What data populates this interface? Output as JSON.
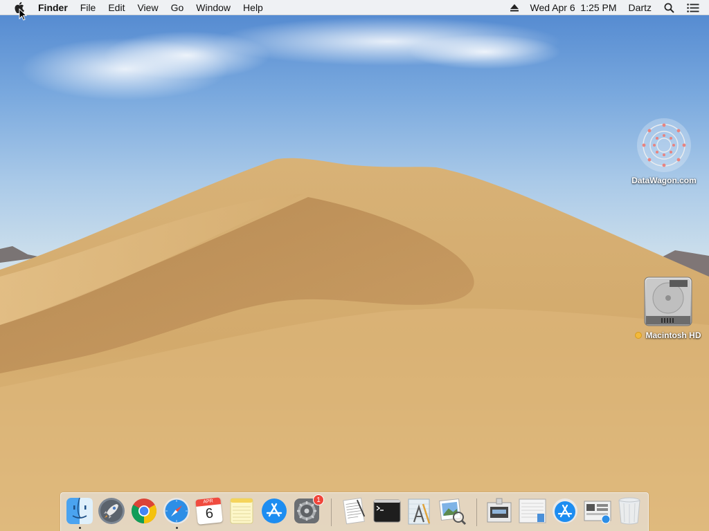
{
  "menubar": {
    "app_name": "Finder",
    "menus": [
      "File",
      "Edit",
      "View",
      "Go",
      "Window",
      "Help"
    ],
    "clock": "Wed Apr 6  1:25 PM",
    "user": "Dartz"
  },
  "desktop": {
    "icons": [
      {
        "label": "DataWagon.com"
      },
      {
        "label": "Macintosh HD",
        "tag_color": "#f2b93b"
      }
    ]
  },
  "dock": {
    "calendar": {
      "month": "APR",
      "day": "6"
    },
    "system_preferences_badge": "1",
    "items": [
      "finder",
      "launchpad",
      "google-chrome",
      "safari",
      "calendar",
      "notes",
      "app-store",
      "system-preferences",
      "textedit",
      "terminal",
      "script-editor",
      "preview",
      "screenshot-folder",
      "documents-folder",
      "app-store-downloads",
      "system-information",
      "trash"
    ]
  }
}
